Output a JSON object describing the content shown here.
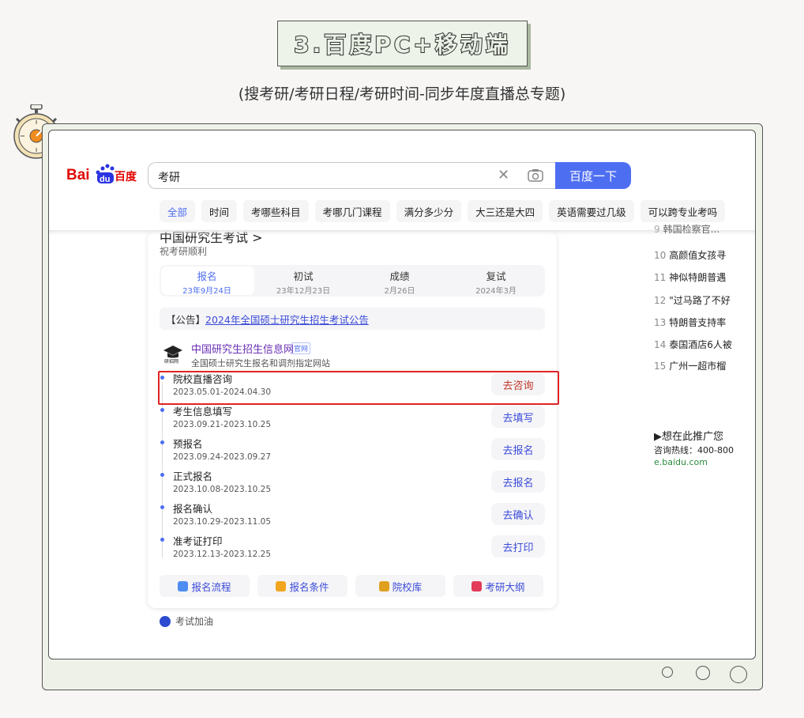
{
  "page": {
    "title": "3.百度PC+移动端",
    "subtitle": "(搜考研/考研日程/考研时间-同步年度直播总专题)"
  },
  "search": {
    "query": "考研",
    "button": "百度一下",
    "logo_text_left": "Bai",
    "logo_text_mid": "du",
    "logo_text_right": "百度"
  },
  "tabs": [
    "全部",
    "时间",
    "考哪些科目",
    "考哪几门课程",
    "满分多少分",
    "大三还是大四",
    "英语需要过几级",
    "可以跨专业考吗"
  ],
  "card": {
    "cut_title": "中国研究生考试 >",
    "sub": "祝考研顺利",
    "steps": [
      {
        "name": "报名",
        "date": "23年9月24日"
      },
      {
        "name": "初试",
        "date": "23年12月23日"
      },
      {
        "name": "成绩",
        "date": "2月26日"
      },
      {
        "name": "复试",
        "date": "2024年3月"
      }
    ],
    "notice_prefix": "【公告】",
    "notice_link": "2024年全国硕士研究生招生考试公告",
    "site_name": "中国研究生招生信息网",
    "site_badge": "官网",
    "site_desc": "全国硕士研究生报名和调剂指定网站",
    "site_icon_label": "研招网",
    "timeline": [
      {
        "name": "院校直播咨询",
        "date": "2023.05.01-2024.04.30",
        "action": "去咨询"
      },
      {
        "name": "考生信息填写",
        "date": "2023.09.21-2023.10.25",
        "action": "去填写"
      },
      {
        "name": "预报名",
        "date": "2023.09.24-2023.09.27",
        "action": "去报名"
      },
      {
        "name": "正式报名",
        "date": "2023.10.08-2023.10.25",
        "action": "去报名"
      },
      {
        "name": "报名确认",
        "date": "2023.10.29-2023.11.05",
        "action": "去确认"
      },
      {
        "name": "准考证打印",
        "date": "2023.12.13-2023.12.25",
        "action": "去打印"
      }
    ],
    "links": [
      "报名流程",
      "报名条件",
      "院校库",
      "考研大纲"
    ],
    "link_colors": [
      "#4e8df2",
      "#f2a51e",
      "#e0a020",
      "#e23c5a"
    ],
    "cheer": "考试加油"
  },
  "rail": {
    "items": [
      {
        "num": "9",
        "text": "韩国检察官..."
      },
      {
        "num": "10",
        "text": "高颜值女孩寻"
      },
      {
        "num": "11",
        "text": "神似特朗普遇"
      },
      {
        "num": "12",
        "text": "\"过马路了不好"
      },
      {
        "num": "13",
        "text": "特朗普支持率"
      },
      {
        "num": "14",
        "text": "泰国酒店6人被"
      },
      {
        "num": "15",
        "text": "广州一超市榴"
      }
    ],
    "ad_title": "▶想在此推广您",
    "ad_phone": "咨询热线：400-800",
    "ad_url": "e.baidu.com"
  }
}
